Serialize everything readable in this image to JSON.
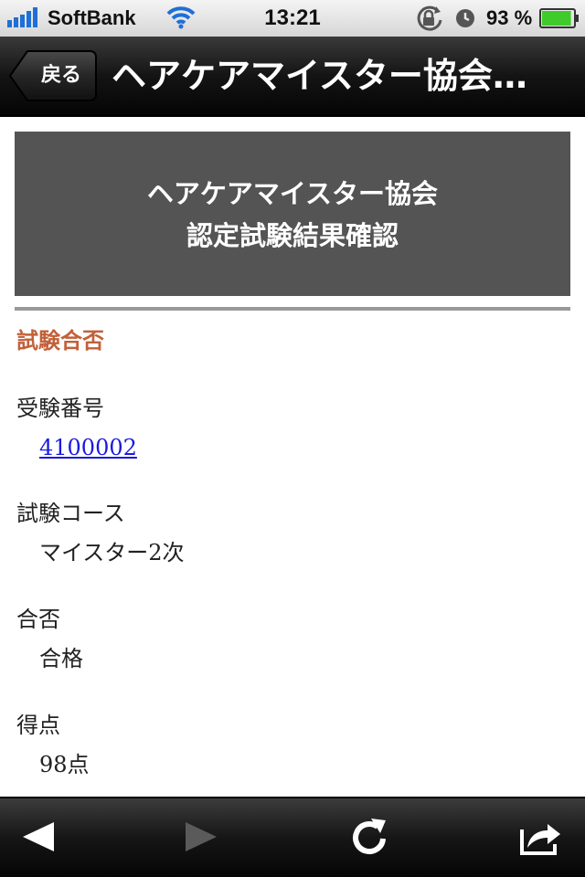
{
  "status_bar": {
    "carrier": "SoftBank",
    "time": "13:21",
    "battery_percent": "93 %",
    "battery_level": 0.93,
    "icons": [
      "signal-icon",
      "wifi-icon",
      "rotation-lock-icon",
      "alarm-icon",
      "battery-icon"
    ]
  },
  "nav": {
    "back_label": "戻る",
    "title": "ヘアケアマイスター協会…"
  },
  "header": {
    "line1": "ヘアケアマイスター協会",
    "line2": "認定試験結果確認"
  },
  "section_title": "試験合否",
  "fields": [
    {
      "label": "受験番号",
      "value": "4100002",
      "is_link": true
    },
    {
      "label": "試験コース",
      "value": "マイスター2次",
      "is_link": false
    },
    {
      "label": "合否",
      "value": "合格",
      "is_link": false
    },
    {
      "label": "得点",
      "value": "98点",
      "is_link": false
    }
  ],
  "toolbar": {
    "icons": [
      "back-arrow-icon",
      "forward-arrow-icon",
      "reload-icon",
      "share-icon"
    ]
  },
  "colors": {
    "header_box": "#545454",
    "section_title": "#c2603a",
    "link": "#1a1adf"
  }
}
